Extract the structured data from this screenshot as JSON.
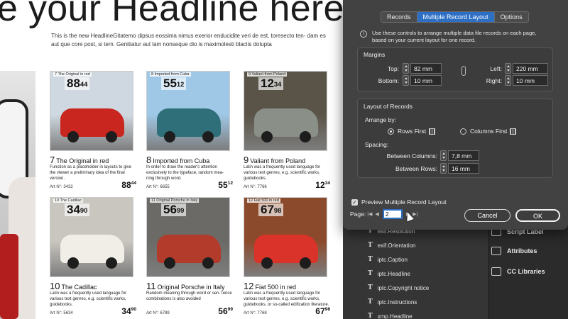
{
  "document": {
    "headline": "e your Headline here",
    "intro": "This is the new HeadlineGitatemo dipsus eossima nimus exerior enducidite veri de est, toresecto ten- dam es aut que core post, si tem. Genitiatur aut lam nonseque dio is maximolesti blaciis dolupta",
    "cards": [
      {
        "tag": "7  The Original in red",
        "big_int": "88",
        "big_dec": "44",
        "num": "7",
        "title": "The Original in red",
        "desc": "Function as a placeholder in layouts to give the viewer a preliminary idea of the final version.",
        "art": "Art N°: 3432",
        "price_int": "88",
        "price_dec": "44",
        "sky": "#cfd8e0",
        "car": "#c8261f"
      },
      {
        "tag": "8  Imported from Cuba",
        "big_int": "55",
        "big_dec": "12",
        "num": "8",
        "title": "Imported from Cuba",
        "desc": "In order to draw the reader's attention exclusively to the typeface, random mea- ning through word.",
        "art": "Art N°: 6655",
        "price_int": "55",
        "price_dec": "12",
        "sky": "#9fc7e6",
        "car": "#2e6f7a"
      },
      {
        "tag": "9  Valiant from Poland",
        "big_int": "12",
        "big_dec": "34",
        "num": "9",
        "title": "Valiant from Poland",
        "desc": "Latin was a frequently used language for various text genres, e.g. scientific works, guidebooks.",
        "art": "Art N°: 7766",
        "price_int": "12",
        "price_dec": "34",
        "sky": "#5a5448",
        "car": "#8a8f88"
      },
      {
        "tag": "10  The Cadillac",
        "big_int": "34",
        "big_dec": "90",
        "num": "10",
        "title": "The Cadillac",
        "desc": "Latin was a frequently used language for various text genres, e.g. scientific works, guidebooks.",
        "art": "Art N°: 5634",
        "price_int": "34",
        "price_dec": "90",
        "sky": "#c9c6bf",
        "car": "#f1eee7"
      },
      {
        "tag": "11  Original Porsche in Italy",
        "big_int": "56",
        "big_dec": "99",
        "num": "11",
        "title": "Original Porsche in Italy",
        "desc": "Random meaning through word or sen- tence combinations is also avoided",
        "art": "Art N°: 6789",
        "price_int": "56",
        "price_dec": "99",
        "sky": "#6b6a66",
        "car": "#b23b2b"
      },
      {
        "tag": "12  Fiat 500 in red",
        "big_int": "67",
        "big_dec": "98",
        "num": "12",
        "title": "Fiat 500 in red",
        "desc": "Latin was a frequently used language for various text genres, e.g. scientific works, guidebooks, or so-called edification literature.",
        "art": "Art N°: 7768",
        "price_int": "67",
        "price_dec": "98",
        "sky": "#8c4a2c",
        "car": "#d9332a"
      }
    ]
  },
  "dialog": {
    "tabs": [
      "Records",
      "Multiple Record Layout",
      "Options"
    ],
    "info": "Use these controls to arrange multiple data file records on each page, based on your current layout for one record.",
    "margins": {
      "title": "Margins",
      "top_label": "Top:",
      "top_value": "82 mm",
      "bottom_label": "Bottom:",
      "bottom_value": "10 mm",
      "left_label": "Left:",
      "left_value": "220 mm",
      "right_label": "Right:",
      "right_value": "10 mm"
    },
    "layout": {
      "title": "Layout of Records",
      "arrange_label": "Arrange by:",
      "rows_first": "Rows First",
      "columns_first": "Columns First",
      "spacing_label": "Spacing:",
      "between_columns_label": "Between Columns:",
      "between_columns_value": "7,8 mm",
      "between_rows_label": "Between Rows:",
      "between_rows_value": "16 mm"
    },
    "preview_label": "Preview Multiple Record Layout",
    "page_label": "Page:",
    "page_value": "2",
    "cancel": "Cancel",
    "ok": "OK"
  },
  "layers": [
    "exif.Resolution",
    "exif.Orientation",
    "iptc.Caption",
    "iptc.Headline",
    "iptc.Copyright notice",
    "iptc.Instructions",
    "xmp.Headline"
  ],
  "side_panels": [
    "Script Label",
    "Attributes",
    "CC Libraries"
  ]
}
